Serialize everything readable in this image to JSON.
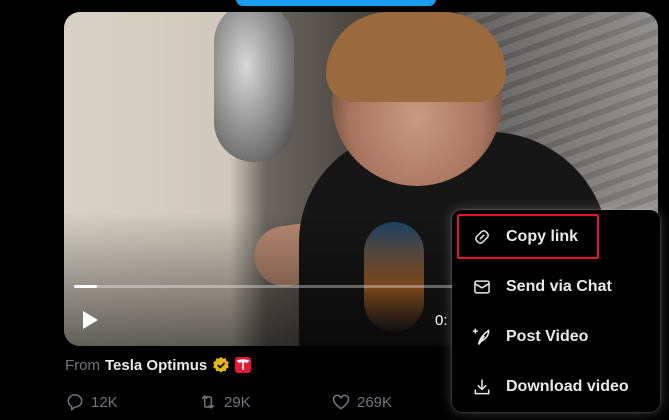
{
  "video": {
    "progress": 0.04,
    "time_text": "0:",
    "play_icon": "play-icon"
  },
  "attribution": {
    "prefix": "From",
    "source": "Tesla Optimus"
  },
  "actions": {
    "replies": "12K",
    "reposts": "29K",
    "likes": "269K"
  },
  "menu": {
    "items": [
      {
        "label": "Copy link",
        "icon": "link-icon"
      },
      {
        "label": "Send via Chat",
        "icon": "envelope-icon"
      },
      {
        "label": "Post Video",
        "icon": "feather-plus-icon"
      },
      {
        "label": "Download video",
        "icon": "download-icon"
      }
    ],
    "highlighted": "Copy link"
  },
  "colors": {
    "accent": "#1d9bf0",
    "highlight_box": "#e0142c",
    "verified_gold": "#e2b719",
    "tesla_red": "#e31937"
  }
}
